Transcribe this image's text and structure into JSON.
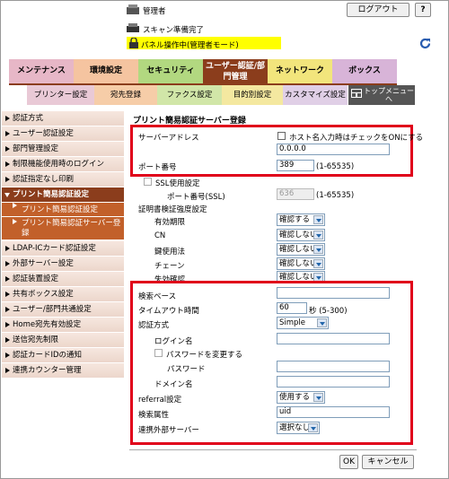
{
  "header": {
    "user_label": "管理者",
    "logout_label": "ログアウト",
    "help_label": "?",
    "status_text": "スキャン準備完了",
    "panel_notice": "パネル操作中(管理者モード)",
    "refresh_icon": "refresh-icon"
  },
  "main_tabs": [
    {
      "label": "メンテナンス",
      "color": "#e7b7c7"
    },
    {
      "label": "環境設定",
      "color": "#f5c4a0"
    },
    {
      "label": "セキュリティ",
      "color": "#b2d880"
    },
    {
      "label": "ユーザー認証/部門管理",
      "color": "#8b3d1c"
    },
    {
      "label": "ネットワーク",
      "color": "#f2e57c"
    },
    {
      "label": "ボックス",
      "color": "#d8b4d8"
    }
  ],
  "sub_tabs": [
    {
      "label": "プリンター設定",
      "color": "#e9c9d6"
    },
    {
      "label": "宛先登録",
      "color": "#f6cda8"
    },
    {
      "label": "ファクス設定",
      "color": "#d1e6a8"
    },
    {
      "label": "目的別設定",
      "color": "#f4e8a0"
    },
    {
      "label": "カスタマイズ設定",
      "color": "#e0cfe6"
    },
    {
      "label": "トップメニューへ",
      "color": "#555555"
    }
  ],
  "sidebar": {
    "items": [
      "認証方式",
      "ユーザー認証設定",
      "部門管理設定",
      "制限機能使用時のログイン",
      "認証指定なし印刷",
      "プリント簡易認証設定",
      "LDAP-ICカード認証設定",
      "外部サーバー設定",
      "認証装置設定",
      "共有ボックス設定",
      "ユーザー/部門共通設定",
      "Home宛先有効設定",
      "送信宛先制限",
      "認証カードIDの通知",
      "連携カウンター管理"
    ],
    "subitems": [
      "プリント簡易認証設定",
      "プリント簡易認証サーバー登録"
    ]
  },
  "form": {
    "title": "プリント簡易認証サーバー登録",
    "server_address_label": "サーバーアドレス",
    "host_name_check_label": "ホスト名入力時はチェックをONにする",
    "server_address_value": "0.0.0.0",
    "port_label": "ポート番号",
    "port_value": "389",
    "port_range": "(1-65535)",
    "ssl_label": "SSL使用設定",
    "ssl_port_label": "ポート番号(SSL)",
    "ssl_port_value": "636",
    "ssl_port_range": "(1-65535)",
    "cert_label": "証明書検証強度設定",
    "cert_rows": [
      {
        "label": "有効期限",
        "value": "確認する"
      },
      {
        "label": "CN",
        "value": "確認しない"
      },
      {
        "label": "鍵使用法",
        "value": "確認しない"
      },
      {
        "label": "チェーン",
        "value": "確認しない"
      },
      {
        "label": "失効確認",
        "value": "確認しない"
      }
    ],
    "search_base_label": "検索ベース",
    "search_base_value": "",
    "timeout_label": "タイムアウト時間",
    "timeout_value": "60",
    "timeout_unit": "秒 (5-300)",
    "auth_method_label": "認証方式",
    "auth_method_value": "Simple",
    "login_name_label": "ログイン名",
    "change_password_label": "パスワードを変更する",
    "password_label": "パスワード",
    "domain_label": "ドメイン名",
    "referral_label": "referral設定",
    "referral_value": "使用する",
    "search_attr_label": "検索属性",
    "search_attr_value": "uid",
    "linked_server_label": "連携外部サーバー",
    "linked_server_value": "選択なし",
    "ok_label": "OK",
    "cancel_label": "キャンセル"
  }
}
